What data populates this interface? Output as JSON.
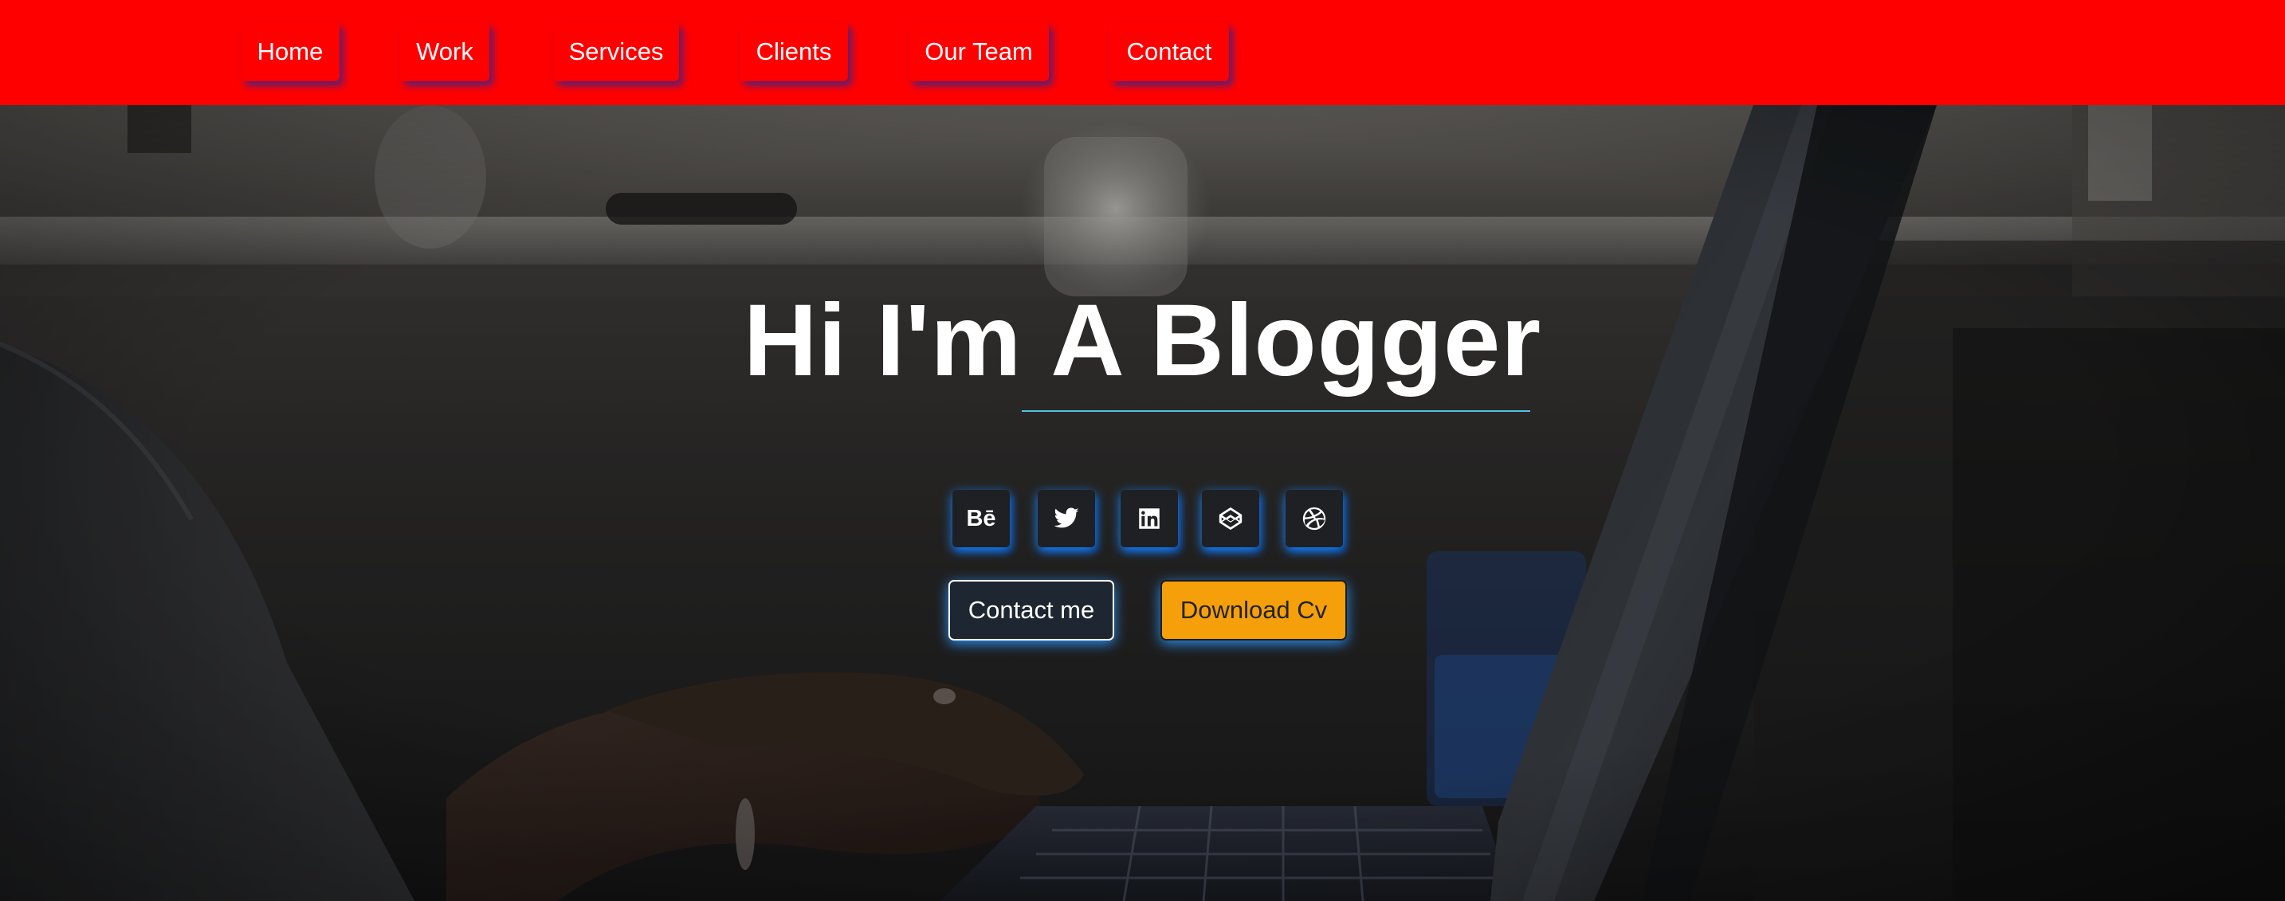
{
  "nav": {
    "items": [
      {
        "label": "Home"
      },
      {
        "label": "Work"
      },
      {
        "label": "Services"
      },
      {
        "label": "Clients"
      },
      {
        "label": "Our Team"
      },
      {
        "label": "Contact"
      }
    ]
  },
  "hero": {
    "title_part1": "Hi I'm",
    "title_part2": "A Blogger",
    "social": [
      {
        "icon": "behance-icon",
        "glyph": "Bē"
      },
      {
        "icon": "twitter-icon"
      },
      {
        "icon": "linkedin-icon"
      },
      {
        "icon": "codepen-icon"
      },
      {
        "icon": "dribbble-icon"
      }
    ],
    "contact_label": "Contact me",
    "download_label": "Download Cv"
  },
  "colors": {
    "nav_bg": "#ff0000",
    "accent_line": "#4fc3e0",
    "download_bg": "#f5a00a",
    "glow": "#1e8cff"
  }
}
